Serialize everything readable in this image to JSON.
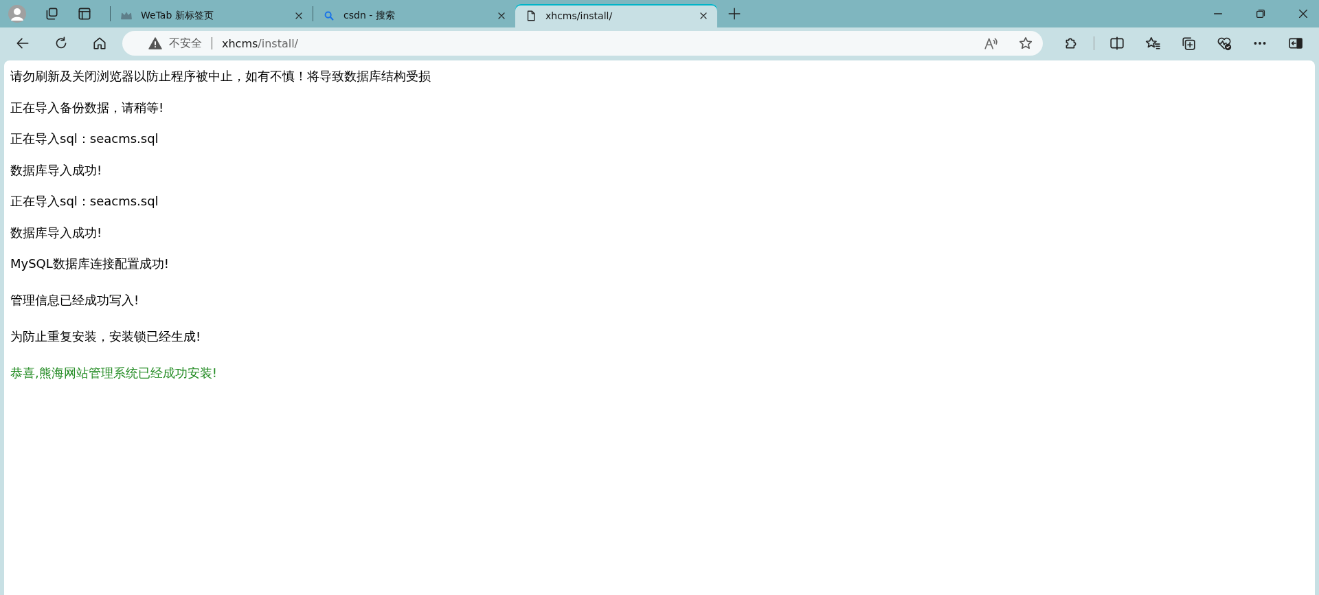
{
  "tabs": [
    {
      "title": "WeTab 新标签页",
      "kind": "crown",
      "selected": false
    },
    {
      "title": "csdn - 搜索",
      "kind": "search",
      "selected": false
    },
    {
      "title": "xhcms/install/",
      "kind": "page",
      "selected": true
    }
  ],
  "address_bar": {
    "security": "不安全",
    "url_host": "xhcms",
    "url_path": "/install/"
  },
  "messages": [
    {
      "text": "请勿刷新及关闭浏览器以防止程序被中止，如有不慎！将导致数据库结构受损",
      "kind": "info"
    },
    {
      "text": "正在导入备份数据，请稍等!",
      "kind": "info"
    },
    {
      "text": "正在导入sql：seacms.sql",
      "kind": "info"
    },
    {
      "text": "数据库导入成功!",
      "kind": "info"
    },
    {
      "text": "正在导入sql：seacms.sql",
      "kind": "info"
    },
    {
      "text": "数据库导入成功!",
      "kind": "info"
    },
    {
      "text": "MySQL数据库连接配置成功!",
      "kind": "info"
    },
    {
      "text": "管理信息已经成功写入!",
      "kind": "info"
    },
    {
      "text": "为防止重复安装，安装锁已经生成!",
      "kind": "info"
    },
    {
      "text": "恭喜,熊海网站管理系统已经成功安装!",
      "kind": "success"
    }
  ]
}
